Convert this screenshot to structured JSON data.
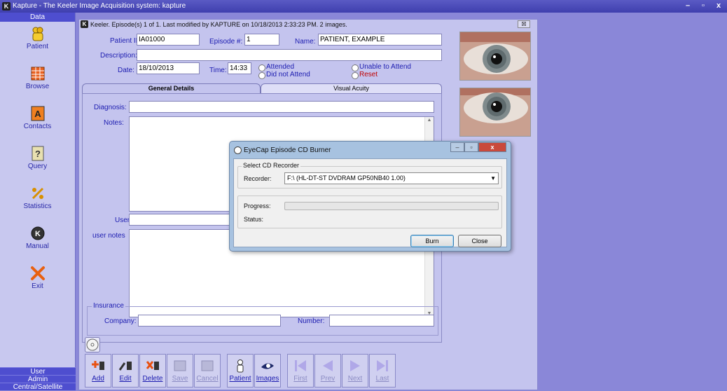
{
  "app": {
    "title": "Kapture - The Keeler Image Acquisition system: kapture",
    "logo": "K",
    "controls": [
      "–",
      "▫",
      "x"
    ]
  },
  "sidebar": {
    "header": "Data",
    "items": [
      {
        "label": "Patient",
        "icon": "patient-icon"
      },
      {
        "label": "Browse",
        "icon": "browse-icon"
      },
      {
        "label": "Contacts",
        "icon": "contacts-icon"
      },
      {
        "label": "Query",
        "icon": "query-icon"
      },
      {
        "label": "Statistics",
        "icon": "statistics-icon"
      },
      {
        "label": "Manual",
        "icon": "manual-icon"
      },
      {
        "label": "Exit",
        "icon": "exit-icon"
      }
    ],
    "bottom": [
      "User",
      "Admin",
      "Central/Satellite"
    ]
  },
  "panel": {
    "title": "Keeler. Episode(s) 1 of 1. Last modified by KAPTURE on 10/18/2013 2:33:23 PM. 2 images.",
    "close": "☒",
    "patient_id_label": "Patient ID #:",
    "patient_id": "IA01000",
    "episode_label": "Episode #:",
    "episode": "1",
    "name_label": "Name:",
    "name": "PATIENT, EXAMPLE",
    "description_label": "Description:",
    "description": "",
    "date_label": "Date:",
    "date": "18/10/2013",
    "time_label": "Time:",
    "time": "14:33",
    "radios": {
      "attended": "Attended",
      "did_not_attend": "Did not Attend",
      "unable": "Unable to Attend",
      "reset": "Reset"
    },
    "tabs": [
      "General Details",
      "Visual Acuity"
    ],
    "diagnosis_label": "Diagnosis:",
    "notes_label": "Notes:",
    "user6_label": "User 6",
    "user_notes_label": "user notes",
    "insurance_label": "Insurance",
    "company_label": "Company:",
    "number_label": "Number:"
  },
  "toolbar": {
    "buttons": [
      {
        "label": "Add",
        "icon": "add-icon",
        "enabled": true
      },
      {
        "label": "Edit",
        "icon": "edit-icon",
        "enabled": true
      },
      {
        "label": "Delete",
        "icon": "delete-icon",
        "enabled": true
      },
      {
        "label": "Save",
        "icon": "save-icon",
        "enabled": false
      },
      {
        "label": "Cancel",
        "icon": "cancel-icon",
        "enabled": false
      },
      {
        "label": "Patient",
        "icon": "patient-icon",
        "enabled": true
      },
      {
        "label": "Images",
        "icon": "images-icon",
        "enabled": true
      },
      {
        "label": "First",
        "icon": "first-icon",
        "enabled": false
      },
      {
        "label": "Prev",
        "icon": "prev-icon",
        "enabled": false
      },
      {
        "label": "Next",
        "icon": "next-icon",
        "enabled": false
      },
      {
        "label": "Last",
        "icon": "last-icon",
        "enabled": false
      }
    ]
  },
  "dialog": {
    "title": "EyeCap Episode CD Burner",
    "group_title": "Select CD Recorder",
    "recorder_label": "Recorder:",
    "recorder_value": "F:\\ (HL-DT-ST DVDRAM GP50NB40 1.00)",
    "progress_label": "Progress:",
    "progress": 0,
    "status_label": "Status:",
    "status_value": "",
    "burn_label": "Burn",
    "close_label": "Close"
  },
  "colors": {
    "desktop": "#8a87d8",
    "accent": "#4e4ecf",
    "label_blue": "#1c1cb0",
    "reset_red": "#c00000"
  }
}
